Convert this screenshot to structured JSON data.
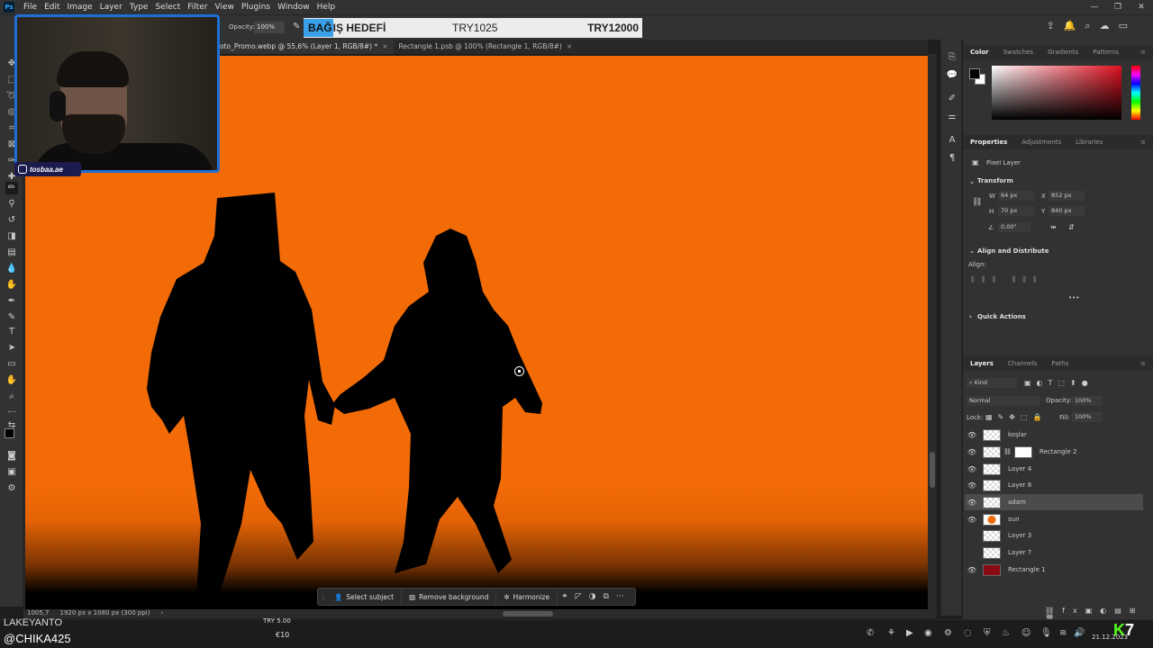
{
  "app": {
    "logo": "Ps"
  },
  "menu": [
    "File",
    "Edit",
    "Image",
    "Layer",
    "Type",
    "Select",
    "Filter",
    "View",
    "Plugins",
    "Window",
    "Help"
  ],
  "window_controls": {
    "minimize": "—",
    "restore": "❐",
    "close": "✕"
  },
  "options": {
    "opacity_label": "Opacity:",
    "opacity_value": "100%"
  },
  "donation": {
    "title_highlight": "BAĞ",
    "title_rest": "IŞ HEDEFİ",
    "current": "TRY1025",
    "goal": "TRY12000"
  },
  "tabs": [
    {
      "label": "oto_Promo.webp @ 55,6% (Layer 1, RGB/8#) *",
      "close": "×"
    },
    {
      "label": "Rectangle 1.psb @ 100% (Rectangle 1, RGB/8#)",
      "close": "×"
    }
  ],
  "statusbar": {
    "zoom": "1005,7",
    "doc": "1920 px x 1080 px (300 ppi)",
    "arrow": "›"
  },
  "contextual_bar": {
    "select_subject": "Select subject",
    "remove_background": "Remove background",
    "harmonize": "Harmonize",
    "more": "···"
  },
  "color_panel": {
    "tabs": [
      "Color",
      "Swatches",
      "Gradients",
      "Patterns"
    ]
  },
  "properties_panel": {
    "tabs": [
      "Properties",
      "Adjustments",
      "Libraries"
    ],
    "layer_type": "Pixel Layer",
    "transform_heading": "Transform",
    "w_label": "W",
    "w_value": "64 px",
    "h_label": "H",
    "h_value": "70 px",
    "x_label": "X",
    "x_value": "852 px",
    "y_label": "Y",
    "y_value": "840 px",
    "angle_value": "0,00°",
    "align_heading": "Align and Distribute",
    "align_label": "Align:",
    "more": "•••",
    "quick_actions": "Quick Actions"
  },
  "layers_panel": {
    "tabs": [
      "Layers",
      "Channels",
      "Paths"
    ],
    "filter_kind": "Kind",
    "blend_mode": "Normal",
    "opacity_label": "Opacity:",
    "opacity_value": "100%",
    "lock_label": "Lock:",
    "fill_label": "Fill:",
    "fill_value": "100%",
    "layers": [
      {
        "name": "koşlar",
        "visible": true,
        "selected": false
      },
      {
        "name": "Rectangle 2",
        "visible": true,
        "selected": false
      },
      {
        "name": "Layer 4",
        "visible": true,
        "selected": false
      },
      {
        "name": "Layer 8",
        "visible": true,
        "selected": false
      },
      {
        "name": "adam",
        "visible": true,
        "selected": true
      },
      {
        "name": "sun",
        "visible": true,
        "selected": false
      },
      {
        "name": "Layer 3",
        "visible": false,
        "selected": false
      },
      {
        "name": "Layer 7",
        "visible": false,
        "selected": false
      },
      {
        "name": "Rectangle 1",
        "visible": true,
        "selected": false
      }
    ]
  },
  "overlay": {
    "instagram_handle": "tosbaa.ae",
    "streamer_top": "LAKEYANTO",
    "streamer_name": "@CHIKA425",
    "try_amount": "TRY 5.00",
    "euro_amount": "€10",
    "kick_logo": "K",
    "kick_num": "7",
    "clock_date": "21.12.2023"
  },
  "colors": {
    "canvas_orange": "#f26b06",
    "donation_highlight": "#3aa0e8",
    "webcam_border": "#1d6fd6",
    "kick_green": "#53fc18"
  }
}
